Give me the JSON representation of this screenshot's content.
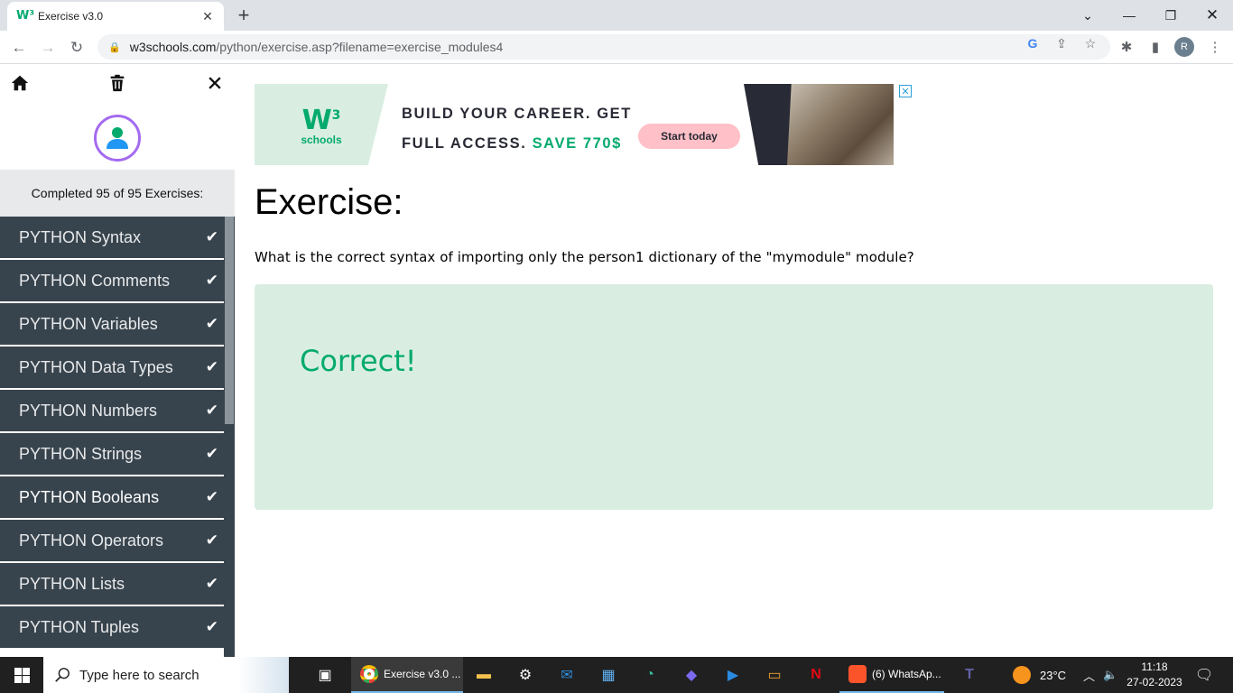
{
  "browser": {
    "tab_title": "Exercise v3.0",
    "tab_favicon": "w3",
    "new_tab": "+",
    "url_host": "w3schools.com",
    "url_path": "/python/exercise.asp?filename=exercise_modules4",
    "profile_initial": "R"
  },
  "sidebar": {
    "completed_text": "Completed 95 of 95 Exercises:",
    "items": [
      {
        "label": "PYTHON Syntax"
      },
      {
        "label": "PYTHON Comments"
      },
      {
        "label": "PYTHON Variables"
      },
      {
        "label": "PYTHON Data Types"
      },
      {
        "label": "PYTHON Numbers"
      },
      {
        "label": "PYTHON Strings"
      },
      {
        "label": "PYTHON Booleans"
      },
      {
        "label": "PYTHON Operators"
      },
      {
        "label": "PYTHON Lists"
      },
      {
        "label": "PYTHON Tuples"
      }
    ],
    "active_item": "PYTHON Booleans"
  },
  "ad": {
    "logo_mark": "W",
    "logo_sup": "3",
    "logo_text": "schools",
    "line1": "BUILD YOUR CAREER. GET",
    "line2_prefix": "FULL ACCESS.",
    "line2_highlight": "SAVE 770$",
    "cta": "Start today",
    "close": "✕"
  },
  "main": {
    "title": "Exercise:",
    "question": "What is the correct syntax of importing only the person1 dictionary of the \"mymodule\" module?",
    "result": "Correct!"
  },
  "taskbar": {
    "search_placeholder": "Type here to search",
    "chrome_app": "Exercise v3.0 ...",
    "whatsapp_app": "(6) WhatsAp...",
    "weather": "23°C",
    "time": "11:18",
    "date": "27-02-2023"
  },
  "colors": {
    "accent_green": "#04aa6d",
    "sidebar_dark": "#38444d",
    "answer_bg": "#d9eee1"
  }
}
